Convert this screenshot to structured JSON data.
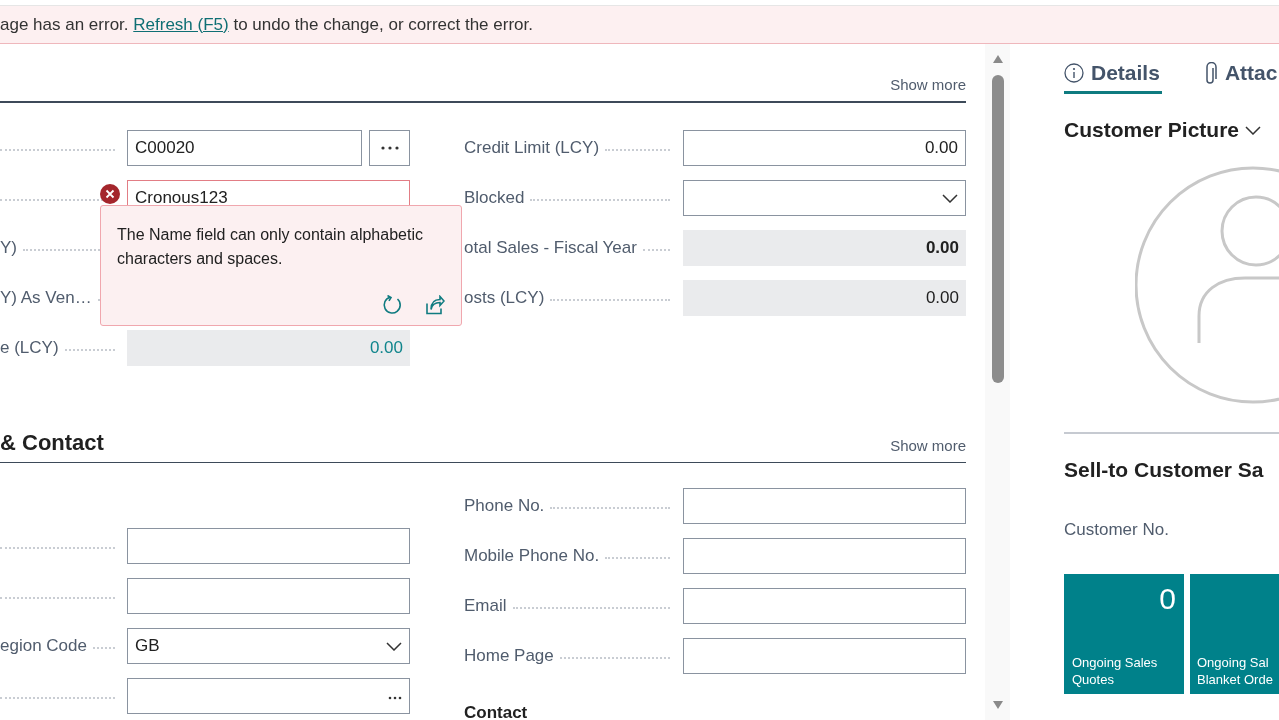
{
  "error_banner": {
    "text_before": "age has an error.",
    "link": "Refresh (F5)",
    "text_after": "to undo the change, or correct the error."
  },
  "sections": [
    {
      "show_more": "Show more",
      "left": [
        {
          "kind": "lookup",
          "value": "C00020"
        },
        {
          "kind": "text",
          "value": "Cronous123",
          "error": true
        },
        {
          "label": "Y)"
        },
        {
          "label": "Y) As Ven…"
        },
        {
          "label": "e (LCY)",
          "kind": "drilldown",
          "value": "0.00"
        }
      ],
      "right": [
        {
          "label": "Credit Limit (LCY)",
          "kind": "number",
          "value": "0.00"
        },
        {
          "label": "Blocked",
          "kind": "dropdown"
        },
        {
          "label": "otal Sales - Fiscal Year",
          "kind": "readonly",
          "value": "0.00",
          "emphasis": true
        },
        {
          "label": "osts (LCY)",
          "kind": "readonly",
          "value": "0.00"
        }
      ],
      "popover": {
        "message": "The Name field can only contain alphabetic characters and spaces."
      }
    },
    {
      "title": "& Contact",
      "show_more": "Show more",
      "left": [
        {
          "kind": "text"
        },
        {
          "kind": "text"
        },
        {
          "label": "egion Code",
          "kind": "dropdown",
          "value": "GB"
        },
        {
          "kind": "assist"
        }
      ],
      "right": [
        {
          "label": "Phone No.",
          "kind": "text"
        },
        {
          "label": "Mobile Phone No.",
          "kind": "text"
        },
        {
          "label": "Email",
          "kind": "text"
        },
        {
          "label": "Home Page",
          "kind": "text"
        },
        {
          "label": "Contact",
          "kind": "heading"
        }
      ]
    }
  ],
  "factbox": {
    "tabs": [
      {
        "label": "Details",
        "selected": true
      },
      {
        "label": "Attac",
        "selected": false
      }
    ],
    "picture_heading": "Customer Picture",
    "sales_heading": "Sell-to Customer Sa",
    "customer_no_label": "Customer No.",
    "tiles": [
      {
        "value": "0",
        "label_lines": [
          "Ongoing Sales",
          "Quotes"
        ]
      },
      {
        "label_lines": [
          "Ongoing Sal",
          "Blanket Orde"
        ]
      }
    ]
  }
}
